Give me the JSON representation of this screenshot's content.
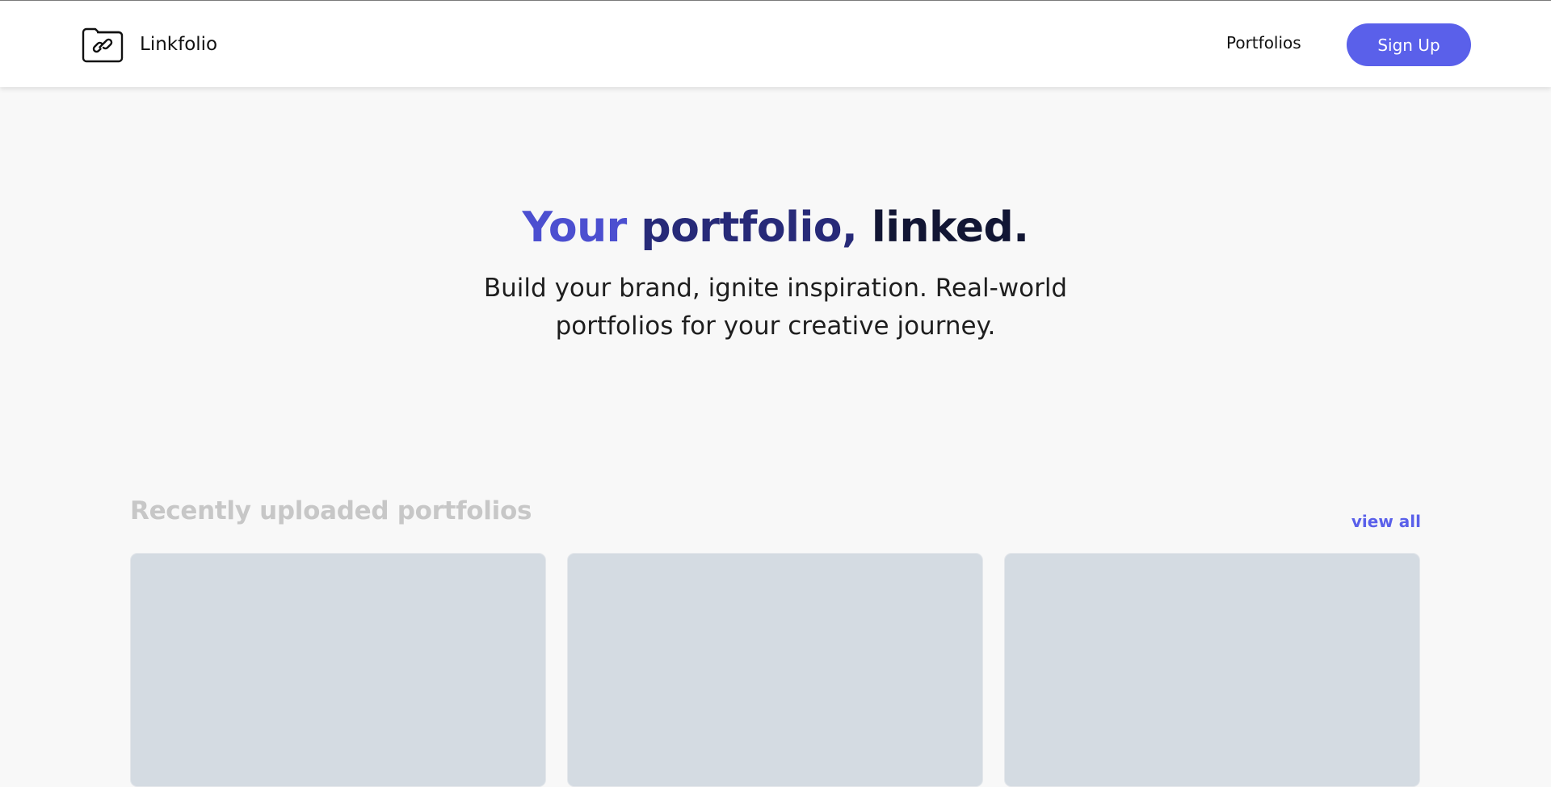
{
  "header": {
    "brand_name": "Linkfolio",
    "logo_icon": "folder-link-icon",
    "nav": {
      "portfolios_label": "Portfolios",
      "signup_label": "Sign Up"
    }
  },
  "hero": {
    "title_part1": "Your",
    "title_part2": "portfolio,",
    "title_part3": "linked.",
    "subtitle": "Build your brand, ignite inspiration. Real-world portfolios for your creative journey."
  },
  "recent": {
    "title": "Recently uploaded portfolios",
    "view_all_label": "view all"
  },
  "colors": {
    "accent": "#5a60ea",
    "title_gradient_start": "#4c4fd0",
    "title_gradient_mid": "#272a78",
    "title_gradient_end": "#121634",
    "card_placeholder": "#d4dbe2",
    "page_background": "#f8f8f8"
  }
}
